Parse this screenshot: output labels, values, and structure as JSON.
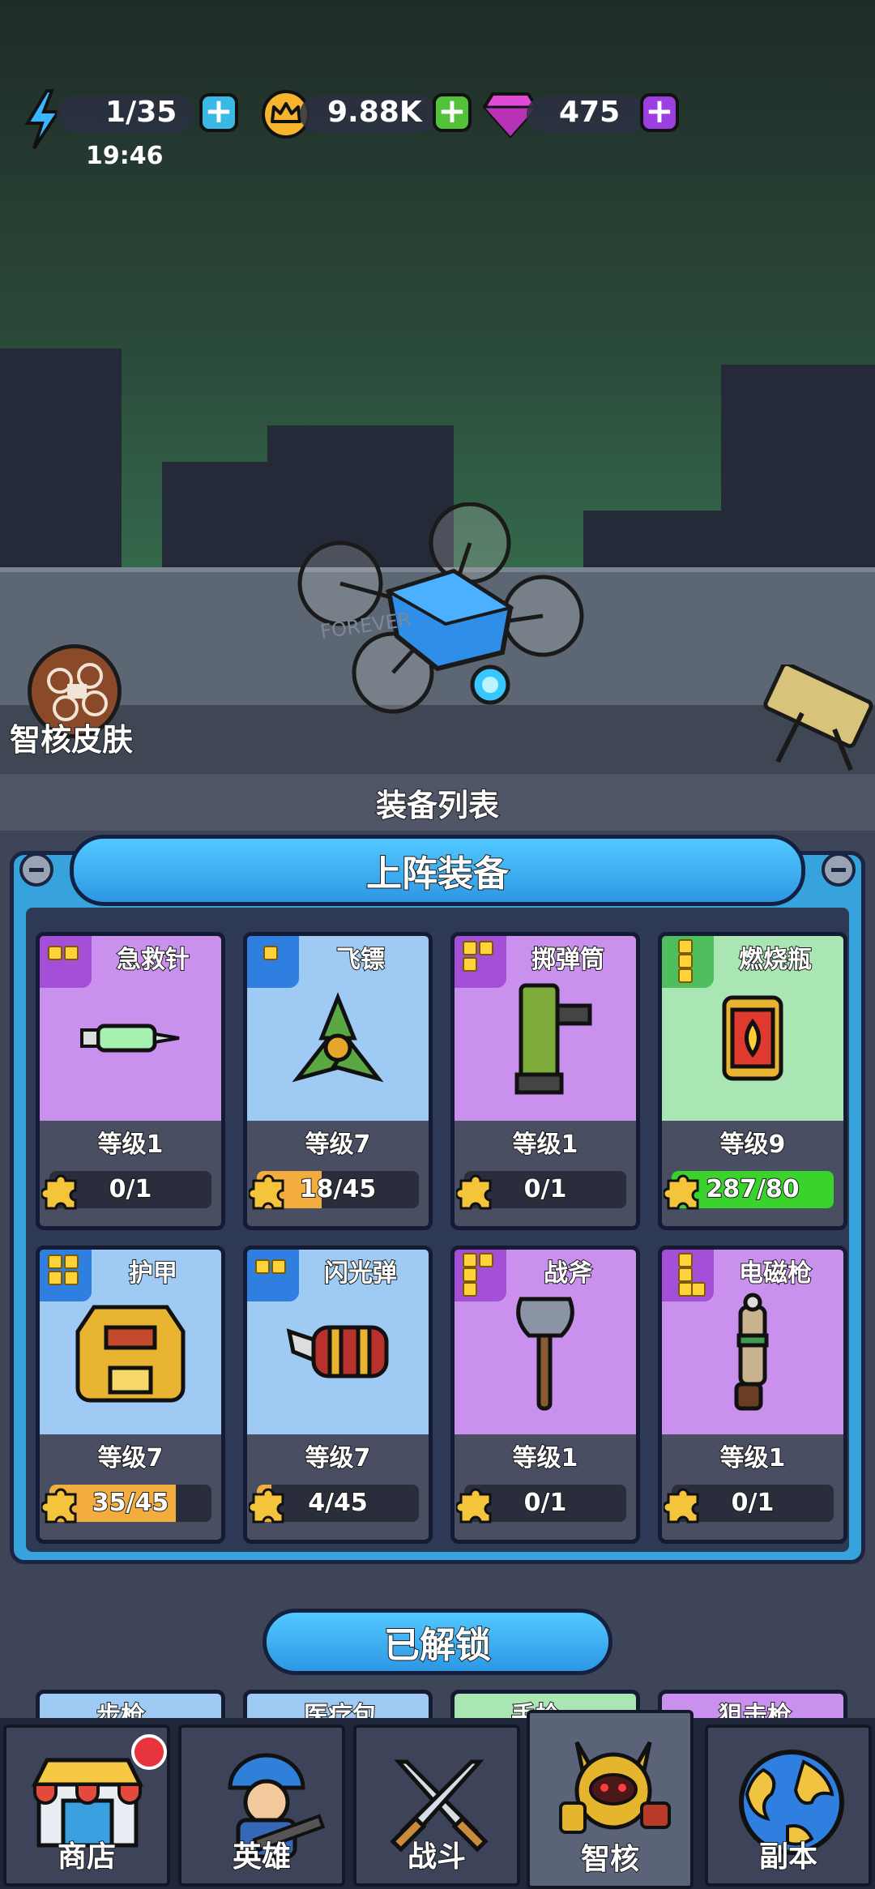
{
  "top_bar": {
    "energy": "1/35",
    "energy_timer": "19:46",
    "coins": "9.88K",
    "gems": "475"
  },
  "scene": {
    "skin_label": "智核皮肤",
    "graffiti": "FOREVER"
  },
  "panel": {
    "title": "装备列表",
    "equipped_label": "上阵装备",
    "unlocked_label": "已解锁"
  },
  "equipped": [
    {
      "name": "急救针",
      "level": "等级1",
      "progress": "0/1",
      "fill": 0,
      "rarity": "purple"
    },
    {
      "name": "飞镖",
      "level": "等级7",
      "progress": "18/45",
      "fill": 0.4,
      "rarity": "blue"
    },
    {
      "name": "掷弹筒",
      "level": "等级1",
      "progress": "0/1",
      "fill": 0,
      "rarity": "purple"
    },
    {
      "name": "燃烧瓶",
      "level": "等级9",
      "progress": "287/80",
      "fill": 1,
      "rarity": "green"
    },
    {
      "name": "护甲",
      "level": "等级7",
      "progress": "35/45",
      "fill": 0.78,
      "rarity": "blue"
    },
    {
      "name": "闪光弹",
      "level": "等级7",
      "progress": "4/45",
      "fill": 0.09,
      "rarity": "blue"
    },
    {
      "name": "战斧",
      "level": "等级1",
      "progress": "0/1",
      "fill": 0,
      "rarity": "purple"
    },
    {
      "name": "电磁枪",
      "level": "等级1",
      "progress": "0/1",
      "fill": 0,
      "rarity": "purple"
    }
  ],
  "unlocked_peek": [
    "步枪",
    "医疗包",
    "手枪",
    "狙击枪"
  ],
  "nav": {
    "shop": "商店",
    "hero": "英雄",
    "battle": "战斗",
    "core": "智核",
    "dungeon": "副本"
  },
  "colors": {
    "purple_top": "#c990ee",
    "blue_top": "#9fcaf3",
    "green_top": "#a9e6b4",
    "accent_blue": "#36a3dc",
    "progress_orange": "#f3ad3f",
    "progress_green": "#39d32c"
  }
}
